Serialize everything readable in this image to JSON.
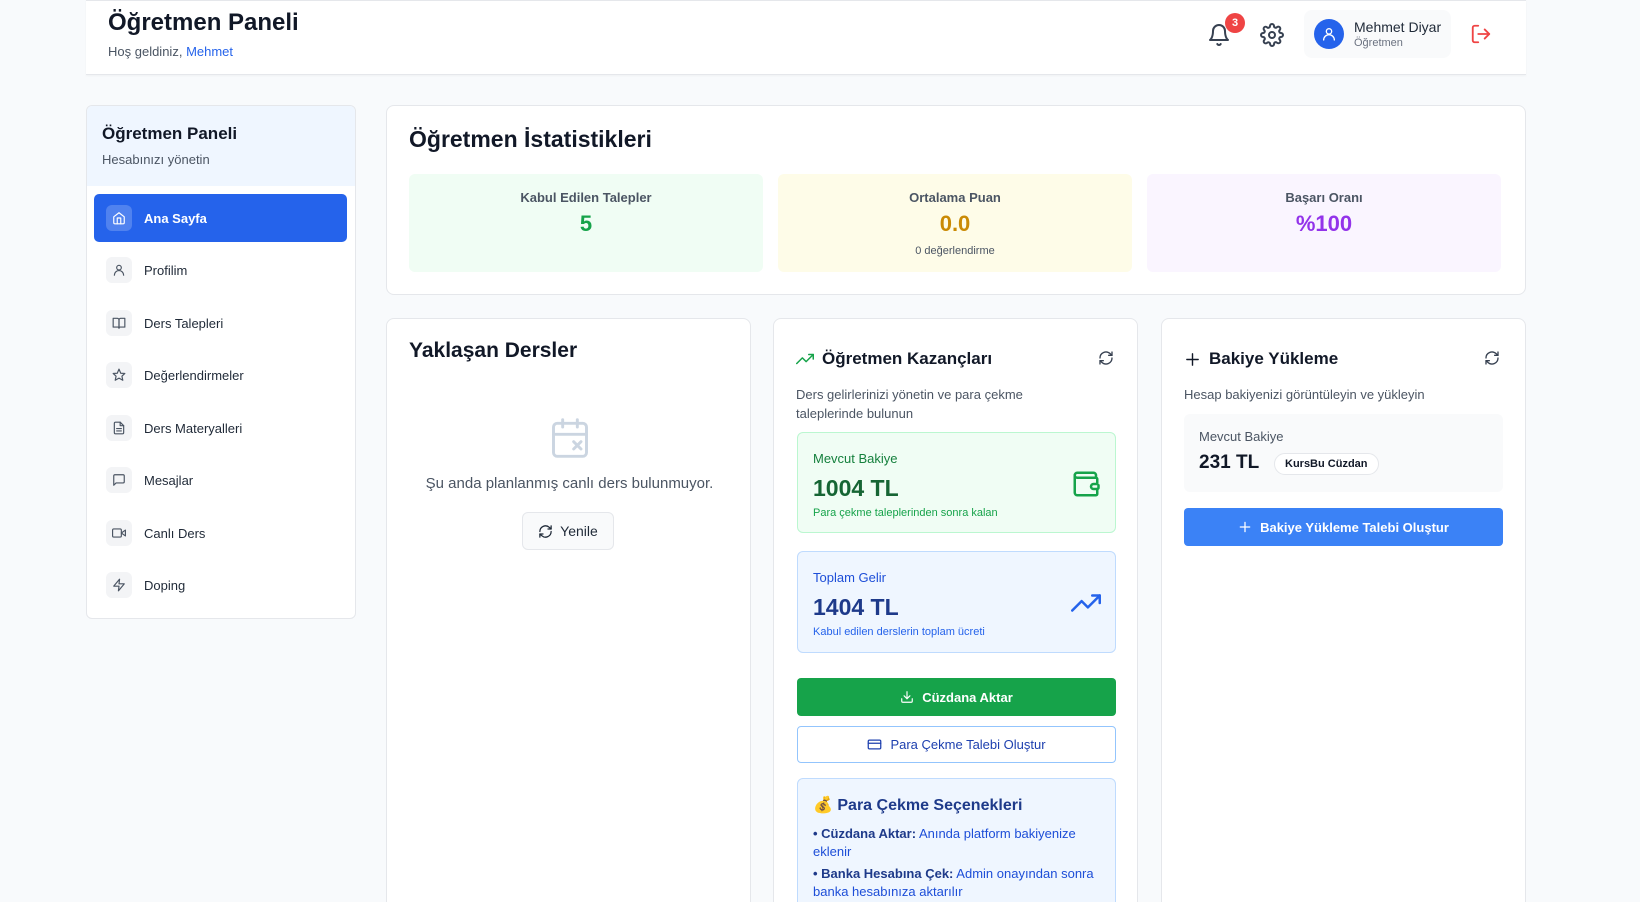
{
  "header": {
    "title": "Öğretmen Paneli",
    "welcome_prefix": "Hoş geldiniz,",
    "welcome_name": "Mehmet",
    "notification_count": "3",
    "user_name": "Mehmet Diyar",
    "user_role": "Öğretmen"
  },
  "sidebar": {
    "title": "Öğretmen Paneli",
    "subtitle": "Hesabınızı yönetin",
    "items": [
      {
        "label": "Ana Sayfa",
        "icon": "home-icon",
        "active": true
      },
      {
        "label": "Profilim",
        "icon": "user-icon"
      },
      {
        "label": "Ders Talepleri",
        "icon": "book-icon"
      },
      {
        "label": "Değerlendirmeler",
        "icon": "star-icon"
      },
      {
        "label": "Ders Materyalleri",
        "icon": "document-icon"
      },
      {
        "label": "Mesajlar",
        "icon": "message-icon"
      },
      {
        "label": "Canlı Ders",
        "icon": "video-icon"
      },
      {
        "label": "Doping",
        "icon": "bolt-icon"
      }
    ]
  },
  "stats": {
    "title": "Öğretmen İstatistikleri",
    "accepted": {
      "label": "Kabul Edilen Talepler",
      "value": "5",
      "color": "#16a34a",
      "bg": "#f0fdf4"
    },
    "rating": {
      "label": "Ortalama Puan",
      "value": "0.0",
      "sub": "0 değerlendirme",
      "color": "#ca8a04",
      "bg": "#fefce8"
    },
    "success": {
      "label": "Başarı Oranı",
      "value": "%100",
      "color": "#9333ea",
      "bg": "#faf5ff"
    }
  },
  "lessons": {
    "title": "Yaklaşan Dersler",
    "empty_text": "Şu anda planlanmış canlı ders bulunmuyor.",
    "refresh_label": "Yenile"
  },
  "earnings": {
    "title": "Öğretmen Kazançları",
    "description": "Ders gelirlerinizi yönetin ve para çekme taleplerinde bulunun",
    "current": {
      "label": "Mevcut Bakiye",
      "value": "1004 TL",
      "sub": "Para çekme taleplerinden sonra kalan"
    },
    "total": {
      "label": "Toplam Gelir",
      "value": "1404 TL",
      "sub": "Kabul edilen derslerin toplam ücreti"
    },
    "transfer_button": "Cüzdana Aktar",
    "withdraw_button": "Para Çekme Talebi Oluştur",
    "options": {
      "title": "💰 Para Çekme Seçenekleri",
      "opt1_bold": "• Cüzdana Aktar:",
      "opt1_text": "Anında platform bakiyenize eklenir",
      "opt2_bold": "• Banka Hesabına Çek:",
      "opt2_text": "Admin onayından sonra banka hesabınıza aktarılır"
    }
  },
  "topup": {
    "title": "Bakiye Yükleme",
    "description": "Hesap bakiyenizi görüntüleyin ve yükleyin",
    "balance_label": "Mevcut Bakiye",
    "balance_value": "231 TL",
    "wallet_badge": "KursBu Cüzdan",
    "create_button": "Bakiye Yükleme Talebi Oluştur"
  },
  "colors": {
    "primary": "#2563eb",
    "success": "#16a34a",
    "danger": "#ef4444"
  }
}
